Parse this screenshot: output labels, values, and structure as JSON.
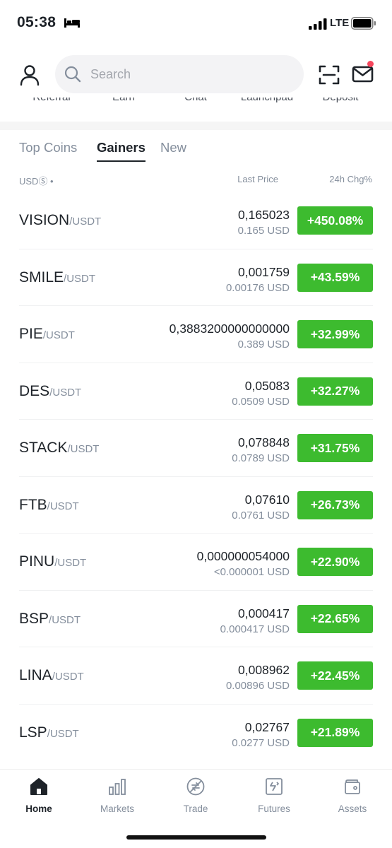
{
  "status_bar": {
    "time": "05:38",
    "network": "LTE",
    "sleep_icon": "bed-icon",
    "signal_icon": "signal-bars-icon",
    "battery_icon": "battery-icon"
  },
  "header": {
    "search": {
      "placeholder": "Search",
      "icon": "search-icon"
    },
    "avatar_icon": "user-icon",
    "scan_icon": "scan-icon",
    "mail_icon": "mail-icon"
  },
  "shortcuts": [
    "Referral",
    "Earn",
    "Chat",
    "Launchpad",
    "Deposit"
  ],
  "tabs": [
    {
      "label": "Top Coins",
      "active": false
    },
    {
      "label": "Gainers",
      "active": true
    },
    {
      "label": "New",
      "active": false
    }
  ],
  "columns": {
    "currency": "USDⓈ •",
    "last_price": "Last Price",
    "change": "24h Chg%"
  },
  "markets": [
    {
      "base": "VISION",
      "quote": "/USDT",
      "price": "0,165023",
      "price_usd": "0.165 USD",
      "change": "+450.08%"
    },
    {
      "base": "SMILE",
      "quote": "/USDT",
      "price": "0,001759",
      "price_usd": "0.00176 USD",
      "change": "+43.59%"
    },
    {
      "base": "PIE",
      "quote": "/USDT",
      "price": "0,3883200000000000",
      "price_usd": "0.389 USD",
      "change": "+32.99%"
    },
    {
      "base": "DES",
      "quote": "/USDT",
      "price": "0,05083",
      "price_usd": "0.0509 USD",
      "change": "+32.27%"
    },
    {
      "base": "STACK",
      "quote": "/USDT",
      "price": "0,078848",
      "price_usd": "0.0789 USD",
      "change": "+31.75%"
    },
    {
      "base": "FTB",
      "quote": "/USDT",
      "price": "0,07610",
      "price_usd": "0.0761 USD",
      "change": "+26.73%"
    },
    {
      "base": "PINU",
      "quote": "/USDT",
      "price": "0,000000054000",
      "price_usd": "<0.000001 USD",
      "change": "+22.90%"
    },
    {
      "base": "BSP",
      "quote": "/USDT",
      "price": "0,000417",
      "price_usd": "0.000417 USD",
      "change": "+22.65%"
    },
    {
      "base": "LINA",
      "quote": "/USDT",
      "price": "0,008962",
      "price_usd": "0.00896 USD",
      "change": "+22.45%"
    },
    {
      "base": "LSP",
      "quote": "/USDT",
      "price": "0,02767",
      "price_usd": "0.0277 USD",
      "change": "+21.89%"
    }
  ],
  "nav": [
    {
      "label": "Home",
      "icon": "home-icon",
      "active": true
    },
    {
      "label": "Markets",
      "icon": "markets-icon",
      "active": false
    },
    {
      "label": "Trade",
      "icon": "trade-icon",
      "active": false
    },
    {
      "label": "Futures",
      "icon": "futures-icon",
      "active": false
    },
    {
      "label": "Assets",
      "icon": "wallet-icon",
      "active": false
    }
  ],
  "colors": {
    "gain": "#3dbb2f",
    "text_primary": "#1e2329",
    "text_secondary": "#848e9c",
    "notification_dot": "#f6465d"
  }
}
